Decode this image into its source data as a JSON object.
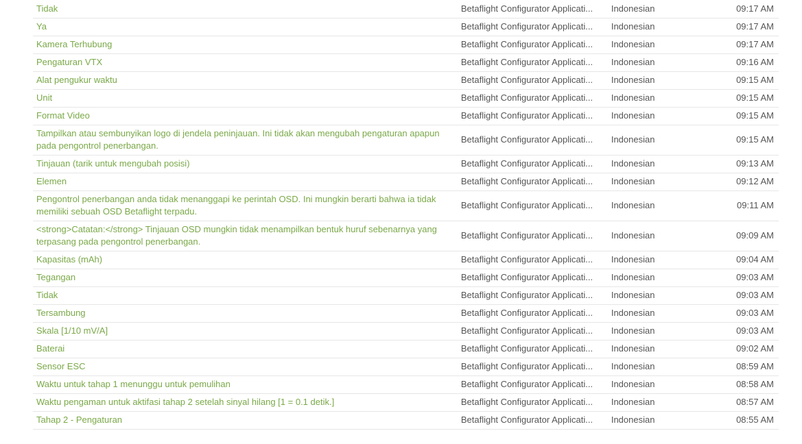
{
  "rows": [
    {
      "string": "Tidak",
      "project": "Betaflight Configurator Applicati...",
      "language": "Indonesian",
      "time": "09:17 AM"
    },
    {
      "string": "Ya",
      "project": "Betaflight Configurator Applicati...",
      "language": "Indonesian",
      "time": "09:17 AM"
    },
    {
      "string": "Kamera Terhubung",
      "project": "Betaflight Configurator Applicati...",
      "language": "Indonesian",
      "time": "09:17 AM"
    },
    {
      "string": "Pengaturan VTX",
      "project": "Betaflight Configurator Applicati...",
      "language": "Indonesian",
      "time": "09:16 AM"
    },
    {
      "string": "Alat pengukur waktu",
      "project": "Betaflight Configurator Applicati...",
      "language": "Indonesian",
      "time": "09:15 AM"
    },
    {
      "string": "Unit",
      "project": "Betaflight Configurator Applicati...",
      "language": "Indonesian",
      "time": "09:15 AM"
    },
    {
      "string": "Format Video",
      "project": "Betaflight Configurator Applicati...",
      "language": "Indonesian",
      "time": "09:15 AM"
    },
    {
      "string": "Tampilkan atau sembunyikan logo di jendela peninjauan. Ini tidak akan mengubah pengaturan apapun pada pengontrol penerbangan.",
      "project": "Betaflight Configurator Applicati...",
      "language": "Indonesian",
      "time": "09:15 AM"
    },
    {
      "string": "Tinjauan (tarik untuk mengubah posisi)",
      "project": "Betaflight Configurator Applicati...",
      "language": "Indonesian",
      "time": "09:13 AM"
    },
    {
      "string": "Elemen",
      "project": "Betaflight Configurator Applicati...",
      "language": "Indonesian",
      "time": "09:12 AM"
    },
    {
      "string": "Pengontrol penerbangan anda tidak menanggapi ke perintah OSD. Ini mungkin berarti bahwa ia tidak memiliki sebuah OSD Betaflight terpadu.",
      "project": "Betaflight Configurator Applicati...",
      "language": "Indonesian",
      "time": "09:11 AM"
    },
    {
      "string": "<strong>Catatan:</strong> Tinjauan OSD mungkin tidak menampilkan bentuk huruf sebenarnya yang terpasang pada pengontrol penerbangan.",
      "project": "Betaflight Configurator Applicati...",
      "language": "Indonesian",
      "time": "09:09 AM"
    },
    {
      "string": "Kapasitas (mAh)",
      "project": "Betaflight Configurator Applicati...",
      "language": "Indonesian",
      "time": "09:04 AM"
    },
    {
      "string": "Tegangan",
      "project": "Betaflight Configurator Applicati...",
      "language": "Indonesian",
      "time": "09:03 AM"
    },
    {
      "string": "Tidak",
      "project": "Betaflight Configurator Applicati...",
      "language": "Indonesian",
      "time": "09:03 AM"
    },
    {
      "string": "Tersambung",
      "project": "Betaflight Configurator Applicati...",
      "language": "Indonesian",
      "time": "09:03 AM"
    },
    {
      "string": "Skala [1/10 mV/A]",
      "project": "Betaflight Configurator Applicati...",
      "language": "Indonesian",
      "time": "09:03 AM"
    },
    {
      "string": "Baterai",
      "project": "Betaflight Configurator Applicati...",
      "language": "Indonesian",
      "time": "09:02 AM"
    },
    {
      "string": "Sensor ESC",
      "project": "Betaflight Configurator Applicati...",
      "language": "Indonesian",
      "time": "08:59 AM"
    },
    {
      "string": "Waktu untuk tahap 1 menunggu untuk pemulihan",
      "project": "Betaflight Configurator Applicati...",
      "language": "Indonesian",
      "time": "08:58 AM"
    },
    {
      "string": "Waktu pengaman untuk aktifasi tahap 2 setelah sinyal hilang [1 = 0.1 detik.]",
      "project": "Betaflight Configurator Applicati...",
      "language": "Indonesian",
      "time": "08:57 AM"
    },
    {
      "string": "Tahap 2 - Pengaturan",
      "project": "Betaflight Configurator Applicati...",
      "language": "Indonesian",
      "time": "08:55 AM"
    }
  ]
}
